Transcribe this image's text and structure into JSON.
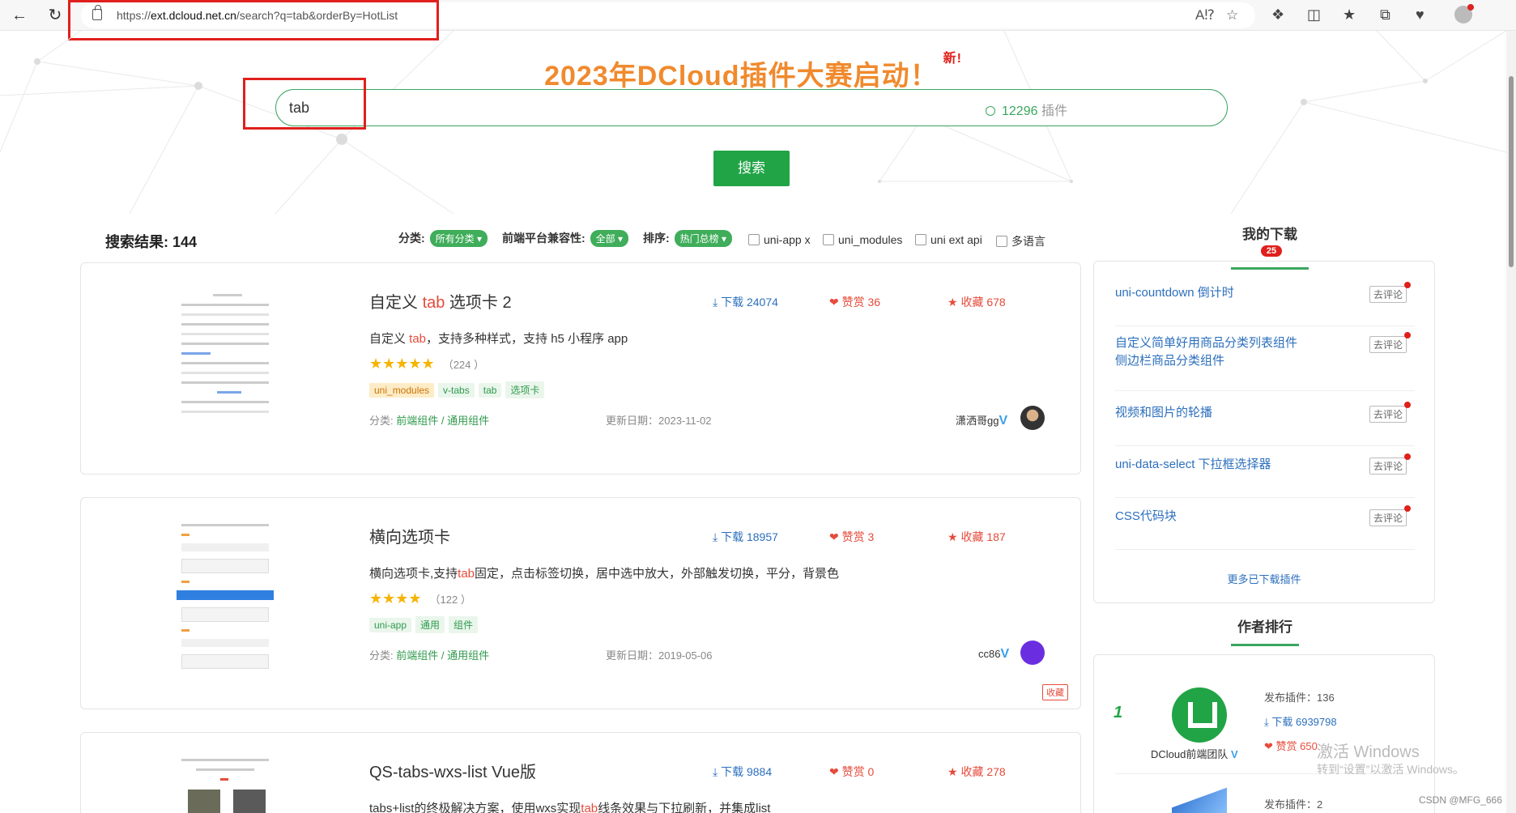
{
  "browser": {
    "url_prefix": "https://",
    "url_host": "ext.dcloud.net.cn",
    "url_path": "/search?q=tab&orderBy=HotList"
  },
  "hero": {
    "title": "2023年DCloud插件大赛启动！",
    "new_label": "新!",
    "search_value": "tab",
    "plugin_count": "12296",
    "plugin_suffix": " 插件",
    "search_button": "搜索"
  },
  "filters": {
    "result_label": "搜索结果: 144",
    "category_label": "分类:",
    "category_value": "所有分类",
    "platform_label": "前端平台兼容性:",
    "platform_value": "全部",
    "sort_label": "排序:",
    "sort_value": "热门总榜",
    "checkboxes": [
      "uni-app x",
      "uni_modules",
      "uni ext api",
      "多语言"
    ]
  },
  "plugins": [
    {
      "title_pre": "自定义 ",
      "title_hl": "tab",
      "title_post": " 选项卡 2",
      "downloads": "下载 24074",
      "likes": "赞赏 36",
      "favorites": "收藏 678",
      "desc_pre": "自定义 ",
      "desc_hl": "tab",
      "desc_post": "，支持多种样式，支持 h5 小程序 app",
      "stars": "★★★★★",
      "review_count": "（224 ）",
      "tags": [
        "uni_modules",
        "v-tabs",
        "tab",
        "选项卡"
      ],
      "category_label": "分类: ",
      "category": "前端组件 / 通用组件",
      "date": "更新日期：2023-11-02",
      "author": "潇洒哥gg"
    },
    {
      "title_pre": "横向选项卡",
      "title_hl": "",
      "title_post": "",
      "downloads": "下载 18957",
      "likes": "赞赏 3",
      "favorites": "收藏 187",
      "desc_pre": "横向选项卡,支持",
      "desc_hl": "tab",
      "desc_post": "固定，点击标签切换，居中选中放大，外部触发切换，平分，背景色",
      "stars": "★★★★",
      "review_count": "（122 ）",
      "tags": [
        "uni-app",
        "通用",
        "组件"
      ],
      "category_label": "分类: ",
      "category": "前端组件 / 通用组件",
      "date": "更新日期：2019-05-06",
      "author": "cc86",
      "fav_badge": "收藏"
    },
    {
      "title_pre": "QS-tabs-wxs-list Vue版",
      "title_hl": "",
      "title_post": "",
      "downloads": "下载 9884",
      "likes": "赞赏 0",
      "favorites": "收藏 278",
      "desc_pre": "tabs+list的终极解决方案，使用wxs实现",
      "desc_hl": "tab",
      "desc_post": "线条效果与下拉刷新，并集成list"
    }
  ],
  "sidebar": {
    "my_downloads": "我的下载",
    "download_count": "25",
    "items": [
      "uni-countdown 倒计时",
      "自定义简单好用商品分类列表组件 侧边栏商品分类组件",
      "视频和图片的轮播",
      "uni-data-select 下拉框选择器",
      "CSS代码块"
    ],
    "comment_button": "去评论",
    "more_link": "更多已下载插件",
    "author_rank": "作者排行",
    "rank1": {
      "no": "1",
      "name": "DCloud前端团队",
      "published": "发布插件：136",
      "downloads": "下载 6939798",
      "likes": "赞赏 650"
    },
    "rank2_published": "发布插件：2"
  },
  "watermark": {
    "line1": "激活 Windows",
    "line2": "转到“设置”以激活 Windows。",
    "csdn": "CSDN @MFG_666"
  },
  "colors": {
    "accent": "#21a446",
    "highlight": "#e64b3b",
    "link": "#2c6fbd",
    "title_orange": "#f08a2d"
  }
}
